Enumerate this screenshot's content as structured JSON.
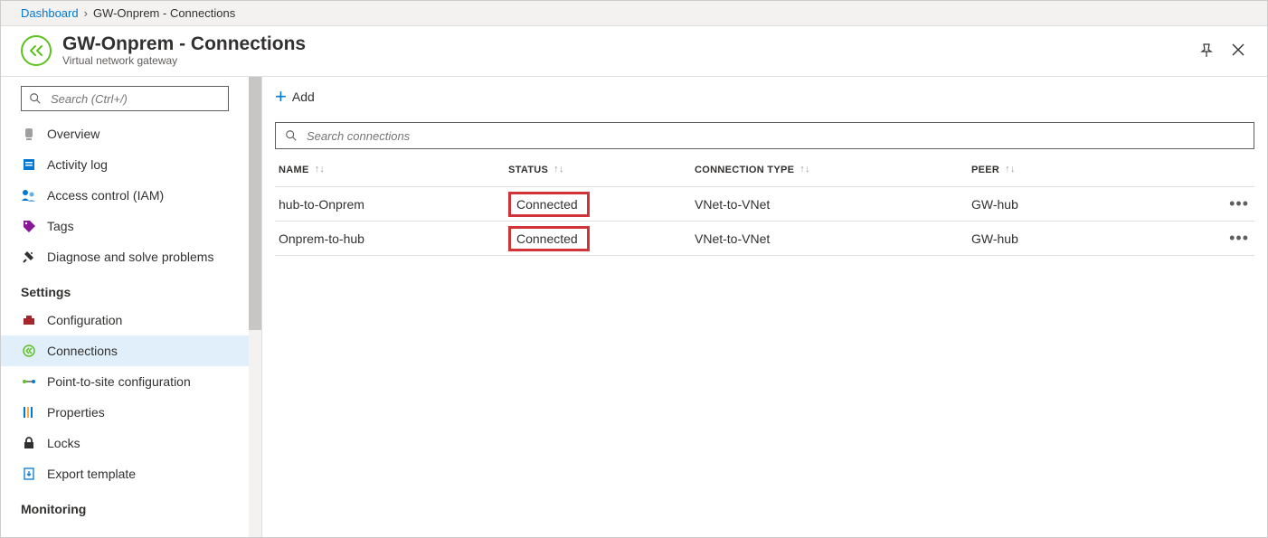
{
  "breadcrumb": {
    "root": "Dashboard",
    "current": "GW-Onprem - Connections"
  },
  "header": {
    "title": "GW-Onprem - Connections",
    "subtitle": "Virtual network gateway"
  },
  "sidebar": {
    "search_placeholder": "Search (Ctrl+/)",
    "items_top": [
      {
        "label": "Overview",
        "icon": "overview"
      },
      {
        "label": "Activity log",
        "icon": "activity"
      },
      {
        "label": "Access control (IAM)",
        "icon": "iam"
      },
      {
        "label": "Tags",
        "icon": "tag"
      },
      {
        "label": "Diagnose and solve problems",
        "icon": "diagnose"
      }
    ],
    "section_settings": "Settings",
    "items_settings": [
      {
        "label": "Configuration",
        "icon": "config"
      },
      {
        "label": "Connections",
        "icon": "connections",
        "active": true
      },
      {
        "label": "Point-to-site configuration",
        "icon": "p2s"
      },
      {
        "label": "Properties",
        "icon": "properties"
      },
      {
        "label": "Locks",
        "icon": "locks"
      },
      {
        "label": "Export template",
        "icon": "export"
      }
    ],
    "section_monitoring": "Monitoring"
  },
  "toolbar": {
    "add_label": "Add"
  },
  "filter": {
    "placeholder": "Search connections"
  },
  "table": {
    "headers": {
      "name": "NAME",
      "status": "STATUS",
      "type": "CONNECTION TYPE",
      "peer": "PEER"
    },
    "rows": [
      {
        "name": "hub-to-Onprem",
        "status": "Connected",
        "type": "VNet-to-VNet",
        "peer": "GW-hub"
      },
      {
        "name": "Onprem-to-hub",
        "status": "Connected",
        "type": "VNet-to-VNet",
        "peer": "GW-hub"
      }
    ]
  }
}
